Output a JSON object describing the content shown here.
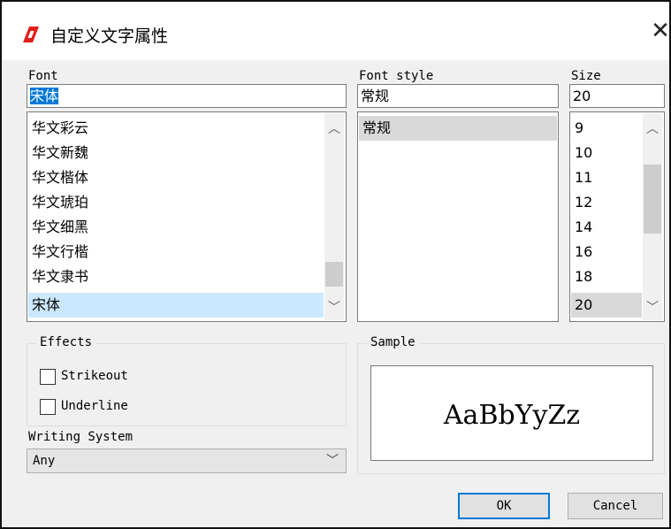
{
  "window": {
    "title": "自定义文字属性",
    "close_glyph": "✕",
    "icon": "app-logo-icon",
    "accent": "#e0201b"
  },
  "font": {
    "label": "Font",
    "value": "宋体",
    "items": [
      "华文彩云",
      "华文新魏",
      "华文楷体",
      "华文琥珀",
      "华文细黑",
      "华文行楷",
      "华文隶书",
      "宋体"
    ],
    "selected": "宋体"
  },
  "style": {
    "label": "Font style",
    "value": "常规",
    "items": [
      "常规"
    ],
    "selected": "常规"
  },
  "size": {
    "label": "Size",
    "value": "20",
    "items": [
      "9",
      "10",
      "11",
      "12",
      "14",
      "16",
      "18",
      "20"
    ],
    "selected": "20"
  },
  "effects": {
    "title": "Effects",
    "strikeout": {
      "label": "Strikeout",
      "checked": false
    },
    "underline": {
      "label": "Underline",
      "checked": false
    }
  },
  "writing_system": {
    "label": "Writing System",
    "value": "Any"
  },
  "sample": {
    "title": "Sample",
    "text": "AaBbYyZz"
  },
  "buttons": {
    "ok": "OK",
    "cancel": "Cancel"
  },
  "colors": {
    "selection_blue": "#cce8ff",
    "selection_gray": "#d9d9d9",
    "default_button_border": "#0078d7"
  }
}
